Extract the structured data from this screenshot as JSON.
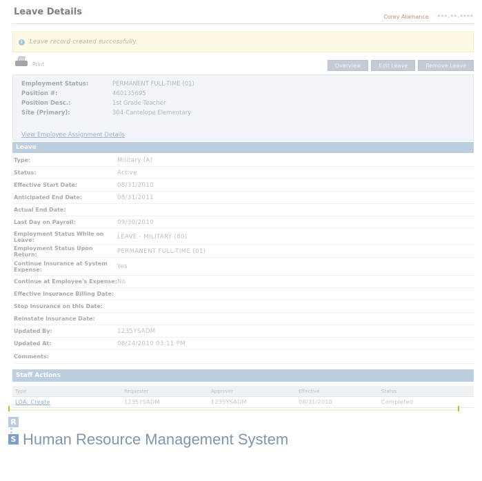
{
  "header": {
    "title": "Leave Details",
    "user_name": "Corey Alamance",
    "user_ssn": "***-**-****"
  },
  "flash": {
    "icon": "info-icon",
    "message": "Leave record created successfully"
  },
  "toolbar": {
    "print_label": "Print",
    "buttons": [
      "Overview",
      "Edit Leave",
      "Remove Leave"
    ]
  },
  "employee": {
    "rows": [
      {
        "label": "Employment Status:",
        "value": "PERMANENT FULL-TIME (01)"
      },
      {
        "label": "Position #:",
        "value": "460135695"
      },
      {
        "label": "Position Desc.:",
        "value": "1st Grade Teacher"
      },
      {
        "label": "Site (Primary):",
        "value": "304-Cantelope Elementary"
      }
    ],
    "assignment_link": "View Employee Assignment Details"
  },
  "leave": {
    "section_title": "Leave",
    "rows": [
      {
        "label": "Type:",
        "value": "Military (A)"
      },
      {
        "label": "Status:",
        "value": "Active"
      },
      {
        "label": "Effective Start Date:",
        "value": "08/31/2010"
      },
      {
        "label": "Anticipated End Date:",
        "value": "08/31/2011"
      },
      {
        "label": "Actual End Date:",
        "value": ""
      },
      {
        "label": "Last Day on Payroll:",
        "value": "09/30/2010"
      },
      {
        "label": "Employment Status While on Leave:",
        "value": "LEAVE - MILITARY (80)"
      },
      {
        "label": "Employment Status Upon Return:",
        "value": "PERMANENT FULL-TIME (01)"
      },
      {
        "label": "Continue Insurance at System Expense:",
        "value": "Yes"
      },
      {
        "label": "Continue at Employee's Expense:",
        "value": "No"
      },
      {
        "label": "Effective Insurance Billing Date:",
        "value": ""
      },
      {
        "label": "Stop Insurance on this Date:",
        "value": ""
      },
      {
        "label": "Reinstate Insurance Date:",
        "value": ""
      },
      {
        "label": "Updated By:",
        "value": "1235YSADM"
      },
      {
        "label": "Updated At:",
        "value": "08/24/2010 03:11 PM"
      },
      {
        "label": "Comments:",
        "value": ""
      }
    ]
  },
  "staff_actions": {
    "section_title": "Staff Actions",
    "columns": [
      "Type",
      "Requester",
      "Approver",
      "Effective",
      "Status"
    ],
    "rows": [
      {
        "type": "LOA: Create",
        "requester": "1235YSADM",
        "approver": "1235YSADM",
        "effective": "08/31/2010",
        "status": "Completed"
      }
    ]
  },
  "footer": {
    "logo_letters": [
      "R",
      "S"
    ],
    "system_name": "Human Resource Management System"
  },
  "colors": {
    "section_bar": "#bccfe0",
    "flash_bg": "#fdf9e3",
    "link": "#8eaacb",
    "accent_green": "#9ccc3c"
  }
}
